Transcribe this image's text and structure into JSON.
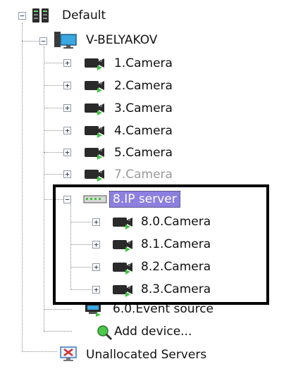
{
  "tree": {
    "root": {
      "label": "Default",
      "expander": "−",
      "icon": "server-rack-icon"
    },
    "computer": {
      "label": "V-BELYAKOV",
      "expander": "−",
      "icon": "computer-icon"
    },
    "cameras": [
      {
        "label": "1.Camera",
        "expander": "+",
        "dim": false
      },
      {
        "label": "2.Camera",
        "expander": "+",
        "dim": false
      },
      {
        "label": "3.Camera",
        "expander": "+",
        "dim": false
      },
      {
        "label": "4.Camera",
        "expander": "+",
        "dim": false
      },
      {
        "label": "5.Camera",
        "expander": "+",
        "dim": false
      },
      {
        "label": "7.Camera",
        "expander": "+",
        "dim": true
      }
    ],
    "ip_server": {
      "label": "8.IP server",
      "expander": "−",
      "selected": true,
      "icon": "ip-server-icon"
    },
    "ip_cameras": [
      {
        "label": "8.0.Camera",
        "expander": "+"
      },
      {
        "label": "8.1.Camera",
        "expander": "+"
      },
      {
        "label": "8.2.Camera",
        "expander": "+"
      },
      {
        "label": "8.3.Camera",
        "expander": "+"
      }
    ],
    "event_source": {
      "label": "6.0.Event source",
      "icon": "event-source-icon"
    },
    "add_device": {
      "label": "Add device...",
      "icon": "add-device-icon"
    },
    "unallocated": {
      "label": "Unallocated Servers",
      "icon": "unallocated-servers-icon"
    }
  },
  "colors": {
    "selection": "#8b7fe0",
    "camera_body": "#2a2a2a",
    "camera_indicator": "#3cc43c",
    "highlight_border": "#000000"
  }
}
